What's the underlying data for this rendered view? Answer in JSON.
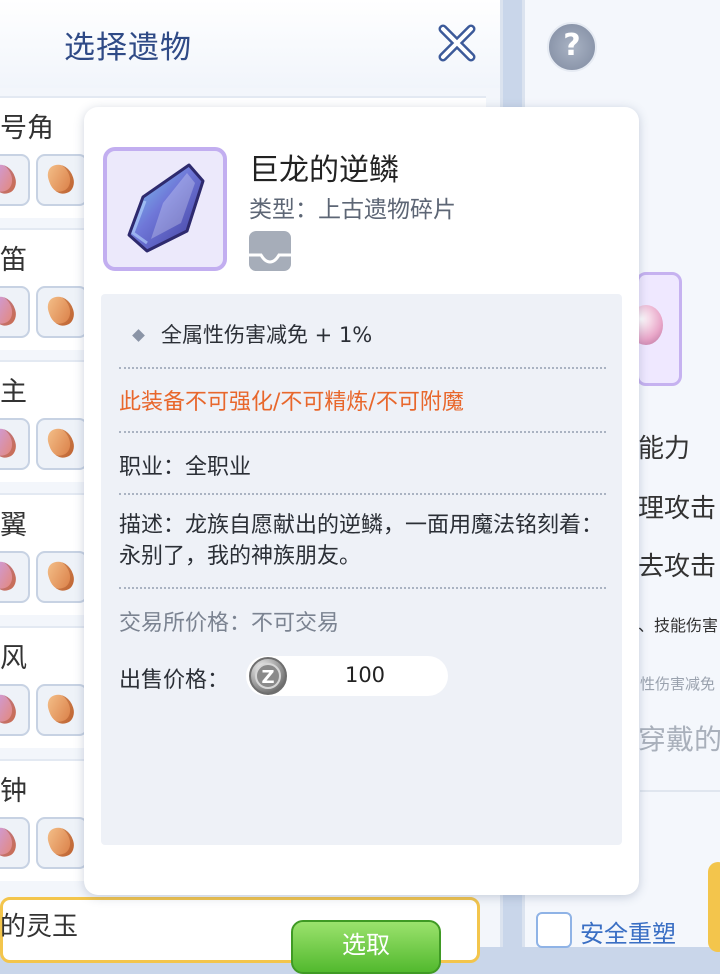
{
  "left_panel": {
    "title": "选择遗物",
    "rows": [
      {
        "label": "号角"
      },
      {
        "label": "笛"
      },
      {
        "label": "主"
      },
      {
        "label": "翼"
      },
      {
        "label": "风"
      },
      {
        "label": "钟"
      }
    ],
    "bottom_label": "的灵玉",
    "select_label": "选取"
  },
  "right_panel": {
    "help_glyph": "?",
    "lines": [
      "能力",
      "理攻击",
      "去攻击",
      "、技能伤害",
      "性伤害减免",
      "穿戴的"
    ],
    "safe_remold_label": "安全重塑"
  },
  "popup": {
    "item_name": "巨龙的逆鳞",
    "item_type": "类型：上古遗物碎片",
    "attribute": "全属性伤害减免 + 1%",
    "warning": "此装备不可强化/不可精炼/不可附魔",
    "job": "职业：全职业",
    "description": "描述：龙族自愿献出的逆鳞，一面用魔法铭刻着：永别了，我的神族朋友。",
    "trade": "交易所价格：不可交易",
    "sell_label": "出售价格：",
    "sell_price": "100",
    "zeny_glyph": "Z"
  },
  "colors": {
    "title": "#2f4a86",
    "warning": "#e8672c",
    "accent_purple": "#c2aef0",
    "select_green": "#52b92e",
    "highlight_yellow": "#f3c54c"
  }
}
